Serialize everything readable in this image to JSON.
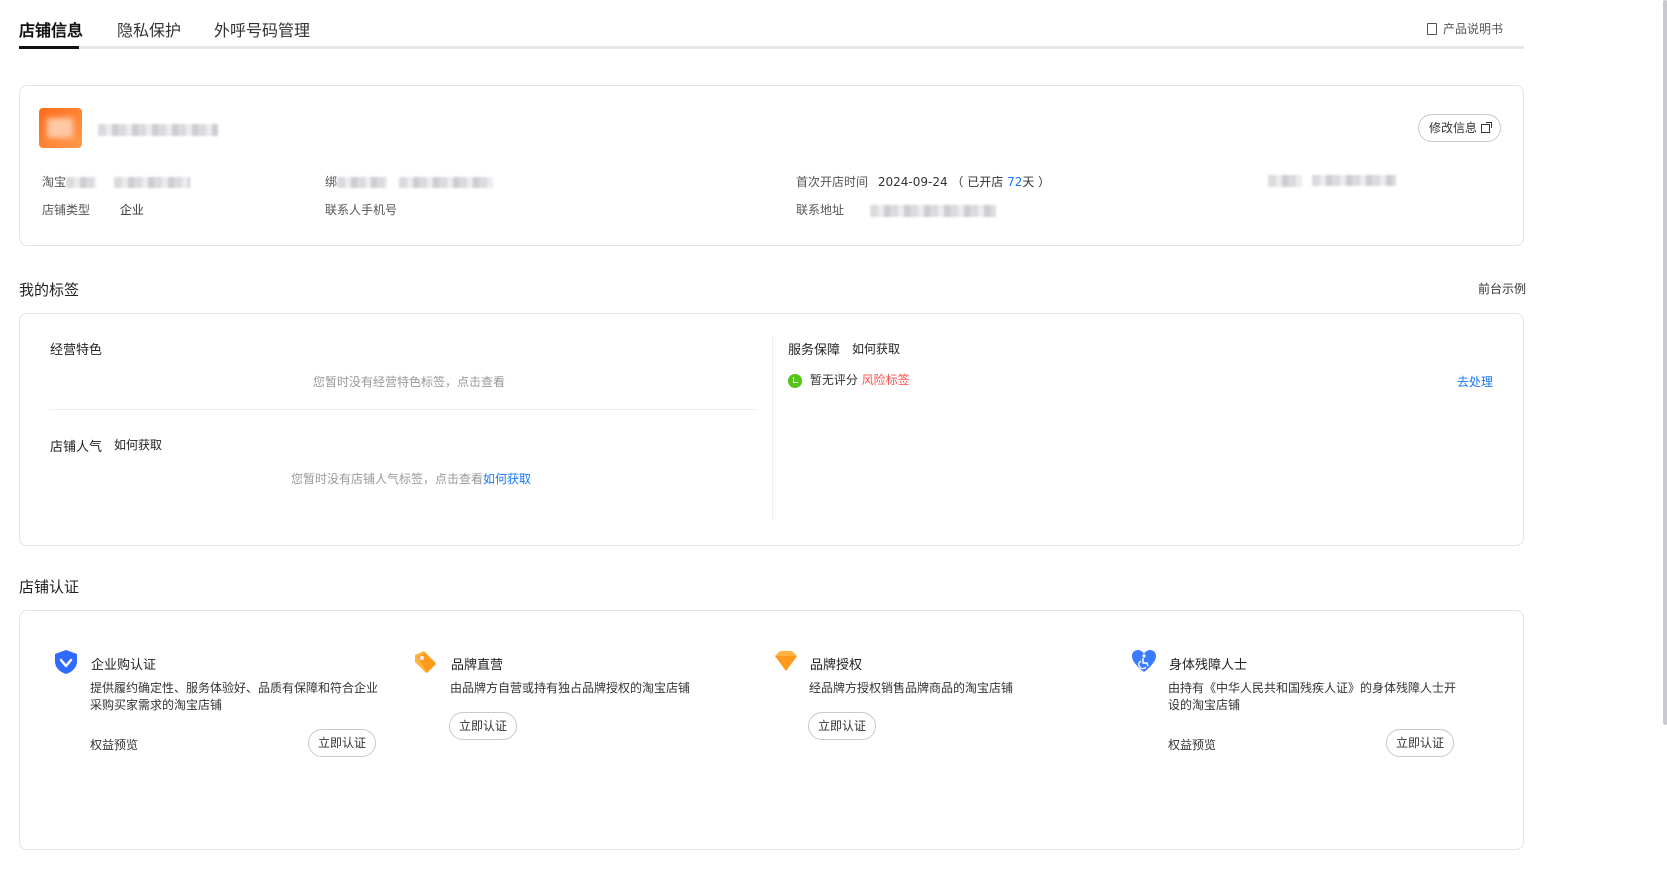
{
  "tabs": [
    {
      "label": "店铺信息",
      "active": true
    },
    {
      "label": "隐私保护",
      "active": false
    },
    {
      "label": "外呼号码管理",
      "active": false
    }
  ],
  "manual_label": "产品说明书",
  "shop": {
    "edit_label": "修改信息",
    "taobao_label": "淘宝",
    "bind_label": "绑",
    "first_open_label": "首次开店时间",
    "first_open_date": "2024-09-24",
    "open_prefix": "（ 已开店 ",
    "open_days": "72",
    "open_suffix": "天 ）",
    "type_label": "店铺类型",
    "type_value": "企业",
    "phone_label": "联系人手机号",
    "address_label": "联系地址"
  },
  "tags_section": {
    "title": "我的标签",
    "preview_label": "前台示例",
    "features_title": "经营特色",
    "features_empty": "您暂时没有经营特色标签，点击查看",
    "popularity_title": "店铺人气",
    "how_to_get": "如何获取",
    "popularity_empty": "您暂时没有店铺人气标签，点击查看",
    "service_title": "服务保障",
    "no_rating": "暂无评分",
    "risk_tag": "风险标签",
    "handle_label": "去处理"
  },
  "cert_section": {
    "title": "店铺认证",
    "items": [
      {
        "title": "企业购认证",
        "desc": "提供履约确定性、服务体验好、品质有保障和符合企业采购买家需求的淘宝店铺",
        "rights": "权益预览",
        "button": "立即认证",
        "icon": "shield-check-icon"
      },
      {
        "title": "品牌直营",
        "desc": "由品牌方自营或持有独占品牌授权的淘宝店铺",
        "button": "立即认证",
        "icon": "tag-icon"
      },
      {
        "title": "品牌授权",
        "desc": "经品牌方授权销售品牌商品的淘宝店铺",
        "button": "立即认证",
        "icon": "diamond-icon"
      },
      {
        "title": "身体残障人士",
        "desc": "由持有《中华人民共和国残疾人证》的身体残障人士开设的淘宝店铺",
        "rights": "权益预览",
        "button": "立即认证",
        "icon": "accessibility-heart-icon"
      }
    ]
  },
  "colors": {
    "link": "#1677ff",
    "risk": "#ff4d4f",
    "success": "#52c41a",
    "brand_orange": "#ff6a1a"
  }
}
